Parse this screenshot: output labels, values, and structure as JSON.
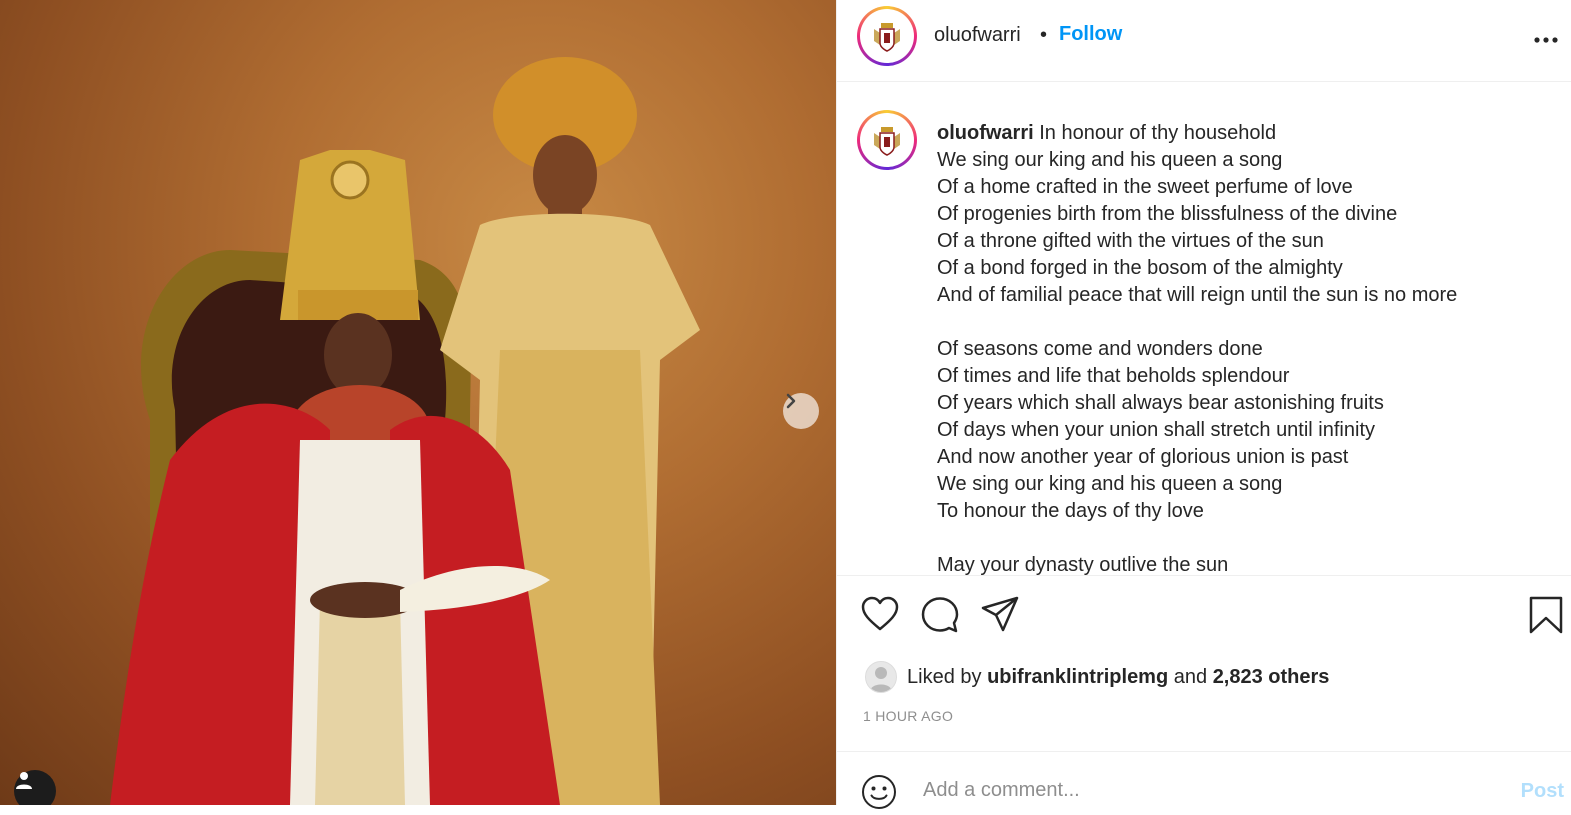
{
  "header": {
    "username": "oluofwarri",
    "separator": "•",
    "follow_label": "Follow",
    "more_label": "•••"
  },
  "caption": {
    "username": "oluofwarri",
    "text": "In honour of thy household\nWe sing our king and his queen a song\nOf a home crafted in the sweet perfume of love\nOf progenies birth from the blissfulness of the divine\nOf a throne gifted with the virtues of the sun\nOf a bond forged in the bosom of the almighty\nAnd of familial peace that will reign until the sun is no more\n\nOf seasons come and wonders done\nOf times and life that beholds splendour\nOf years which shall always bear astonishing fruits\nOf days when your union shall stretch until infinity\nAnd now another year of glorious union is past\nWe sing our king and his queen a song\nTo honour the days of thy love\n\nMay your dynasty outlive the sun"
  },
  "likes": {
    "prefix": "Liked by",
    "liker": "ubifranklintriplemg",
    "conjunction": "and",
    "others": "2,823 others"
  },
  "timestamp": "1 HOUR AGO",
  "comment": {
    "placeholder": "Add a comment...",
    "post_label": "Post"
  },
  "icons": {
    "like": "heart-icon",
    "comment": "comment-icon",
    "share": "share-icon",
    "save": "bookmark-icon",
    "emoji": "emoji-icon",
    "next": "chevron-right-icon",
    "tags": "user-tag-icon"
  },
  "colors": {
    "accent": "#0095f6",
    "post_disabled": "#b2dffc",
    "muted": "#8e8e8e"
  }
}
